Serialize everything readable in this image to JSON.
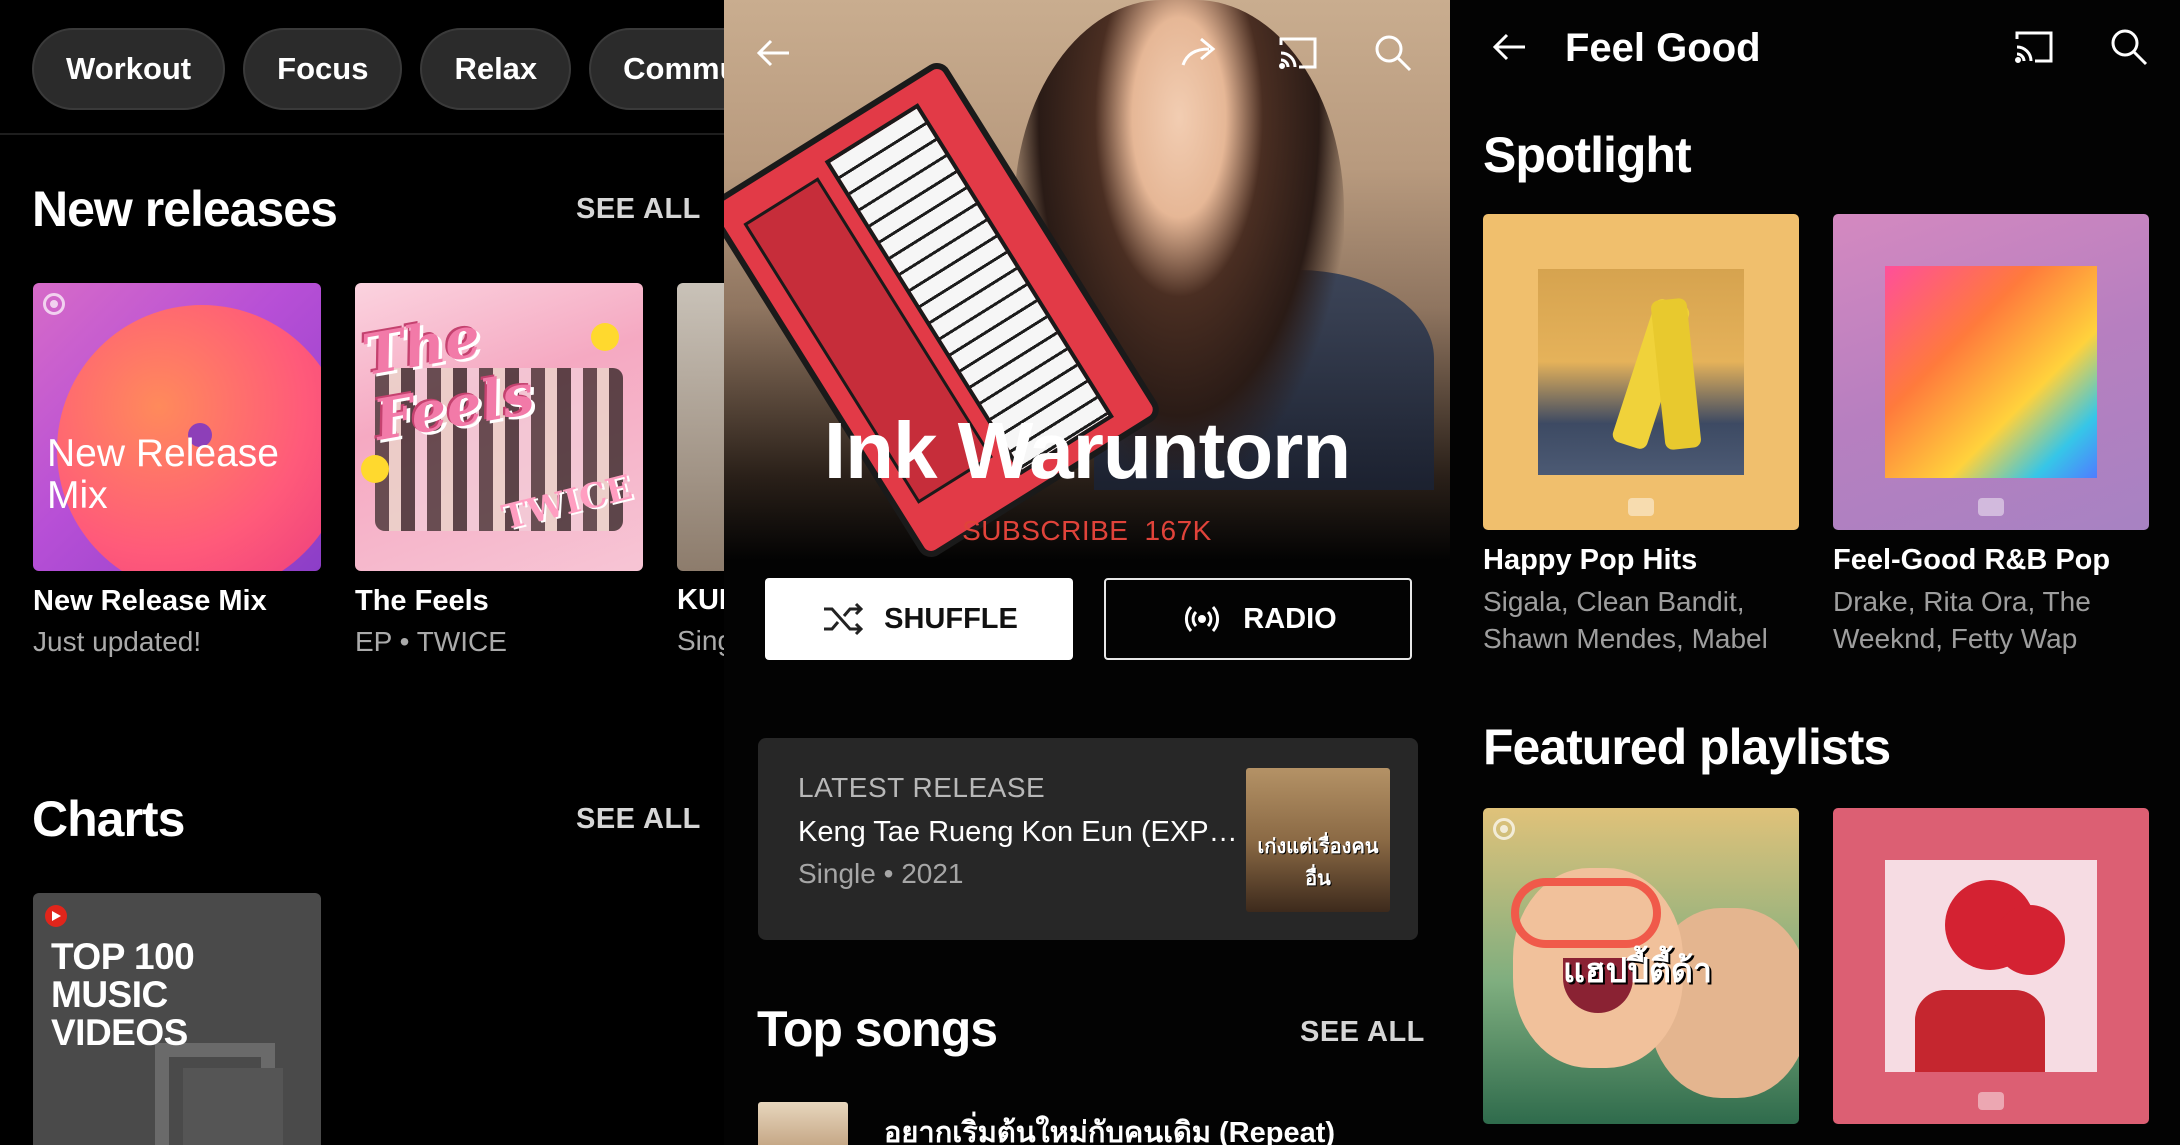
{
  "left": {
    "chips": [
      "Workout",
      "Focus",
      "Relax",
      "Commute"
    ],
    "new_releases": {
      "title": "New releases",
      "see_all": "SEE ALL",
      "items": [
        {
          "title": "New Release Mix",
          "subtitle": "Just updated!",
          "art_text": "New Release Mix"
        },
        {
          "title": "The Feels",
          "subtitle": "EP • TWICE",
          "art_text": "The Feels",
          "art_text_2": "TWICE"
        },
        {
          "title": "KUE SIN",
          "subtitle": "Sing"
        }
      ]
    },
    "charts": {
      "title": "Charts",
      "see_all": "SEE ALL",
      "items": [
        {
          "art_text": "TOP 100 MUSIC VIDEOS"
        }
      ]
    }
  },
  "middle": {
    "artist_name": "Ink Waruntorn",
    "subscribe_label": "SUBSCRIBE",
    "subscriber_count": "167K",
    "shuffle_label": "SHUFFLE",
    "radio_label": "RADIO",
    "latest_release": {
      "label": "LATEST RELEASE",
      "title": "Keng Tae Rueng Kon Eun (EXPER...",
      "subtitle": "Single • 2021",
      "art_text": "เก่งแต่เรื่องคนอื่น"
    },
    "top_songs": {
      "title": "Top songs",
      "see_all": "SEE ALL",
      "first_song": "อยากเริ่มต้นใหม่กับคนเดิม (Repeat)"
    },
    "icons": [
      "back-arrow-icon",
      "share-icon",
      "cast-icon",
      "search-icon"
    ]
  },
  "right": {
    "title": "Feel Good",
    "spotlight": {
      "title": "Spotlight",
      "items": [
        {
          "title": "Happy Pop Hits",
          "subtitle": "Sigala, Clean Bandit, Shawn Mendes, Mabel"
        },
        {
          "title": "Feel-Good R&B Pop",
          "subtitle": "Drake, Rita Ora, The Weeknd, Fetty Wap"
        }
      ]
    },
    "featured": {
      "title": "Featured playlists",
      "items": [
        {
          "art_text": "แฮปปี้ตี้ด้า"
        },
        {}
      ]
    }
  },
  "colors": {
    "background": "#000000",
    "chip_bg": "#2b2b2b",
    "subscribe_red": "#e0433a",
    "card_bg": "#272727",
    "muted_text": "#aaaaaa"
  }
}
